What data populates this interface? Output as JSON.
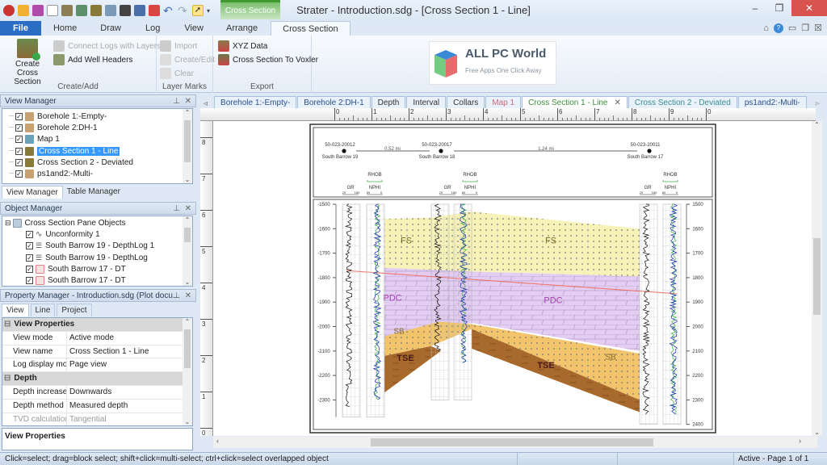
{
  "window": {
    "title": "Strater - Introduction.sdg - [Cross Section 1 - Line]",
    "context_tab_header": "Cross Section",
    "controls": [
      "minimize",
      "restore",
      "close"
    ],
    "mdi_controls": [
      "ribbon-collapse",
      "help",
      "minimize",
      "restore",
      "close"
    ]
  },
  "quick_access": [
    "app-menu",
    "open",
    "save",
    "new",
    "new-borehole",
    "new-map",
    "new-cross-section",
    "new-3d",
    "print",
    "export",
    "import",
    "undo",
    "redo",
    "select",
    "customize"
  ],
  "ribbon": {
    "tabs": [
      {
        "label": "File",
        "type": "file"
      },
      {
        "label": "Home"
      },
      {
        "label": "Draw"
      },
      {
        "label": "Log"
      },
      {
        "label": "View"
      },
      {
        "label": "Arrange"
      },
      {
        "label": "Cross Section",
        "active": true
      }
    ],
    "groups": [
      {
        "label": "Create/Add",
        "items": [
          {
            "label": "Create Cross Section",
            "enabled": true,
            "large": true
          },
          {
            "label": "Connect Logs with Layers",
            "enabled": false
          },
          {
            "label": "Add Well Headers",
            "enabled": true
          }
        ]
      },
      {
        "label": "Layer Marks",
        "items": [
          {
            "label": "Import",
            "enabled": false
          },
          {
            "label": "Create/Edit",
            "enabled": false
          },
          {
            "label": "Clear",
            "enabled": false
          }
        ]
      },
      {
        "label": "Export",
        "items": [
          {
            "label": "XYZ Data",
            "enabled": true
          },
          {
            "label": "Cross Section To Voxler",
            "enabled": true
          }
        ]
      }
    ]
  },
  "watermark": {
    "title": "ALL PC World",
    "subtitle": "Free Apps One Click Away"
  },
  "view_manager": {
    "title": "View Manager",
    "items": [
      {
        "label": "Borehole 1:-Empty-",
        "checked": true,
        "icon": "borehole-icon"
      },
      {
        "label": "Borehole 2:DH-1",
        "checked": true,
        "icon": "borehole-icon"
      },
      {
        "label": "Map 1",
        "checked": true,
        "icon": "map-icon"
      },
      {
        "label": "Cross Section 1 - Line",
        "checked": true,
        "icon": "cross-section-icon",
        "selected": true
      },
      {
        "label": "Cross Section 2 - Deviated",
        "checked": true,
        "icon": "cross-section-icon"
      },
      {
        "label": "ps1and2:-Multi-",
        "checked": true,
        "icon": "borehole-icon"
      }
    ],
    "tabs": [
      "View Manager",
      "Table Manager"
    ]
  },
  "object_manager": {
    "title": "Object Manager",
    "root": "Cross Section Pane Objects",
    "items": [
      {
        "label": "Unconformity 1",
        "checked": true,
        "icon": "unconformity-icon"
      },
      {
        "label": "South Barrow 19 - DepthLog 1",
        "checked": true,
        "icon": "depth-log-icon"
      },
      {
        "label": "South Barrow 19 - DepthLog",
        "checked": true,
        "icon": "depth-log-icon"
      },
      {
        "label": "South Barrow 17 - DT",
        "checked": true,
        "icon": "line-log-icon"
      },
      {
        "label": "South Barrow 17 - DT",
        "checked": true,
        "icon": "line-log-icon"
      }
    ]
  },
  "property_manager": {
    "title": "Property Manager - Introduction.sdg (Plot docu...",
    "tabs": [
      "View",
      "Line",
      "Project"
    ],
    "active_tab": "View",
    "sections": [
      {
        "category": "View Properties",
        "rows": [
          {
            "key": "View mode",
            "value": "Active mode"
          },
          {
            "key": "View name",
            "value": "Cross Section 1 - Line"
          },
          {
            "key": "Log display mode",
            "value": "Page view"
          }
        ]
      },
      {
        "category": "Depth",
        "rows": [
          {
            "key": "Depth increases",
            "value": "Downwards"
          },
          {
            "key": "Depth method",
            "value": "Measured depth"
          },
          {
            "key": "TVD calculation ...",
            "value": "Tangential",
            "disabled": true
          }
        ]
      }
    ],
    "description": "View Properties"
  },
  "doc_tabs": [
    {
      "label": "Borehole 1:-Empty-",
      "color": "#2a4f8f"
    },
    {
      "label": "Borehole 2:DH-1",
      "color": "#2a4f8f"
    },
    {
      "label": "Depth",
      "color": "#333333"
    },
    {
      "label": "Interval",
      "color": "#333333"
    },
    {
      "label": "Collars",
      "color": "#333333"
    },
    {
      "label": "Map 1",
      "color": "#c96a7a"
    },
    {
      "label": "Cross Section 1 - Line",
      "color": "#3b8f3b",
      "active": true,
      "closable": true
    },
    {
      "label": "Cross Section 2 - Deviated",
      "color": "#3b8f8f"
    },
    {
      "label": "ps1and2:-Multi-",
      "color": "#2a4f8f"
    }
  ],
  "rulers": {
    "horizontal": [
      "0",
      "1",
      "2",
      "3",
      "4",
      "5",
      "6",
      "7",
      "8",
      "9",
      "0"
    ],
    "vertical": [
      "8",
      "7",
      "6",
      "5",
      "4",
      "3",
      "2",
      "1",
      "0"
    ]
  },
  "cross_section": {
    "wells": [
      {
        "id": "50-023-20012",
        "name": "South Barrow 19"
      },
      {
        "id": "50-023-20017",
        "name": "South Barrow 18"
      },
      {
        "id": "50-023-20011",
        "name": "South Barrow 17"
      }
    ],
    "distances": [
      "0.52 mi",
      "1.24 mi"
    ],
    "log_headers": {
      "gr": "GR",
      "rhob": "RHOB",
      "nphi": "NPHI",
      "gr_range": [
        "20",
        "180"
      ],
      "nphi_range": [
        "60",
        "0"
      ]
    },
    "left_depth_ticks": [
      "-1500",
      "-1600",
      "-1700",
      "-1800",
      "-1900",
      "-2000",
      "-2100",
      "-2200",
      "-2300"
    ],
    "right_depth_ticks": [
      "1500",
      "1600",
      "1700",
      "1800",
      "1900",
      "2000",
      "2100",
      "2200",
      "2300",
      "2400"
    ],
    "layers": [
      {
        "label": "FS",
        "color": "#f7f3b8"
      },
      {
        "label": "PDC",
        "color": "#e3cdf2"
      },
      {
        "label": "SB",
        "color": "#f2c46b"
      },
      {
        "label": "TSE",
        "color": "#a86a2c"
      }
    ],
    "colors": {
      "unconformity": "#f07060",
      "gr": "#111111",
      "nphi": "#1a2fb0",
      "rhob": "#3cab4a"
    }
  },
  "status": {
    "hint": "Click=select; drag=block select; shift+click=multi-select; ctrl+click=select overlapped object",
    "page": "Active - Page 1 of 1"
  }
}
